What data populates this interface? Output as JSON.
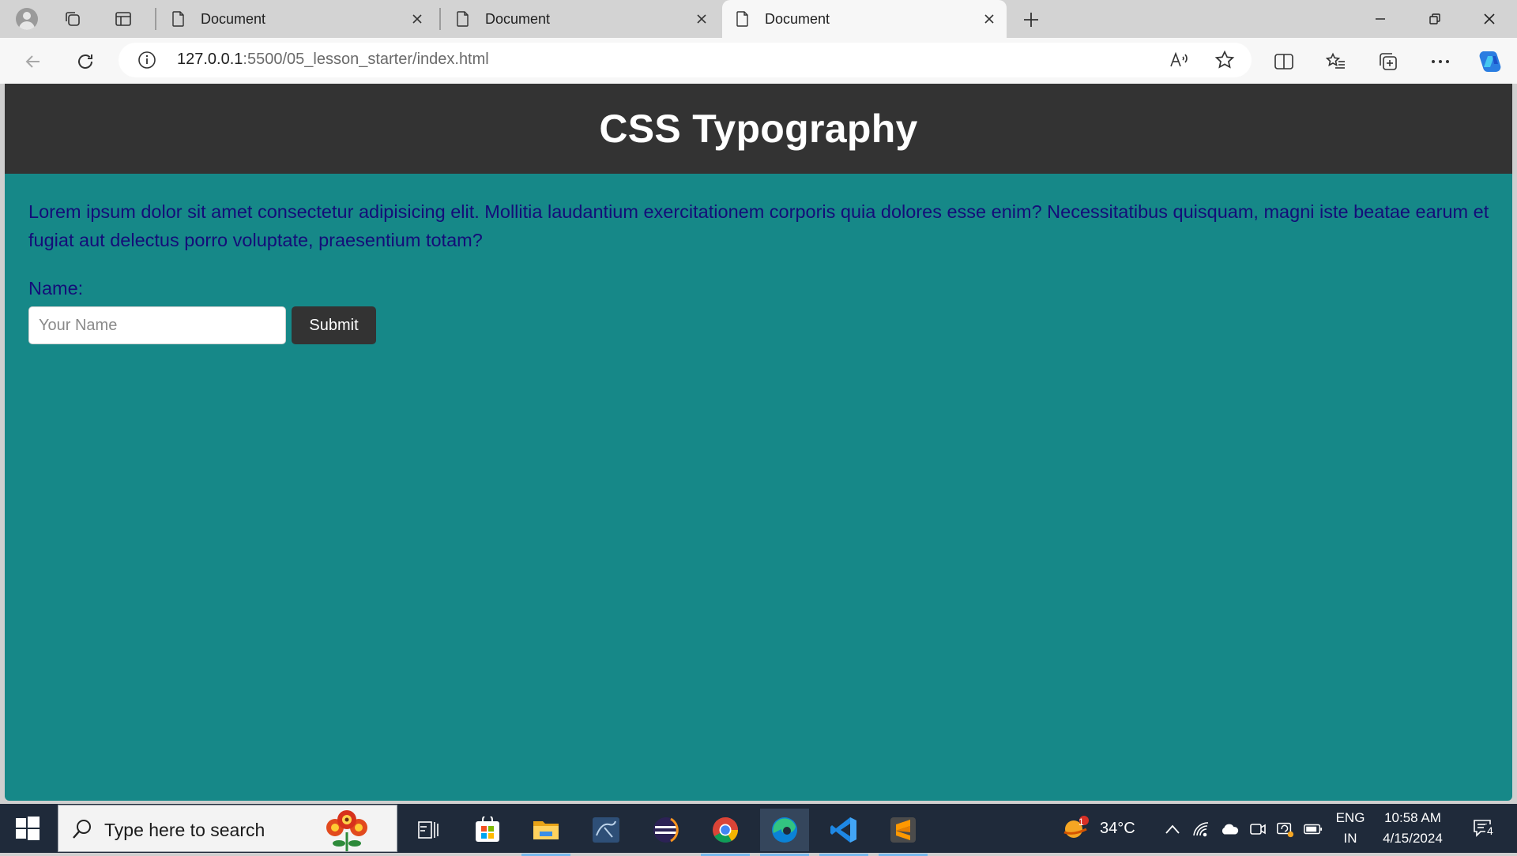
{
  "browser": {
    "tabs": [
      {
        "title": "Document"
      },
      {
        "title": "Document"
      },
      {
        "title": "Document"
      }
    ],
    "active_tab_index": 2,
    "address": {
      "host": "127.0.0.1",
      "path": ":5500/05_lesson_starter/index.html"
    }
  },
  "page": {
    "heading": "CSS Typography",
    "paragraph": "Lorem ipsum dolor sit amet consectetur adipisicing elit. Mollitia laudantium exercitationem corporis quia dolores esse enim? Necessitatibus quisquam, magni iste beatae earum et fugiat aut delectus porro voluptate, praesentium totam?",
    "form": {
      "label": "Name:",
      "input_placeholder": "Your Name",
      "input_value": "",
      "submit_label": "Submit"
    },
    "colors": {
      "header_bg": "#333333",
      "body_bg": "#168888",
      "text": "#140d78"
    }
  },
  "taskbar": {
    "search_placeholder": "Type here to search",
    "apps": [
      "task-view",
      "microsoft-store",
      "file-explorer",
      "mysql-workbench",
      "eclipse",
      "chrome",
      "edge",
      "vscode",
      "sublime-text"
    ],
    "weather": {
      "temperature": "34°C",
      "badge": "1"
    },
    "language": {
      "line1": "ENG",
      "line2": "IN"
    },
    "clock": {
      "time": "10:58 AM",
      "date": "4/15/2024"
    },
    "notifications": "4"
  }
}
